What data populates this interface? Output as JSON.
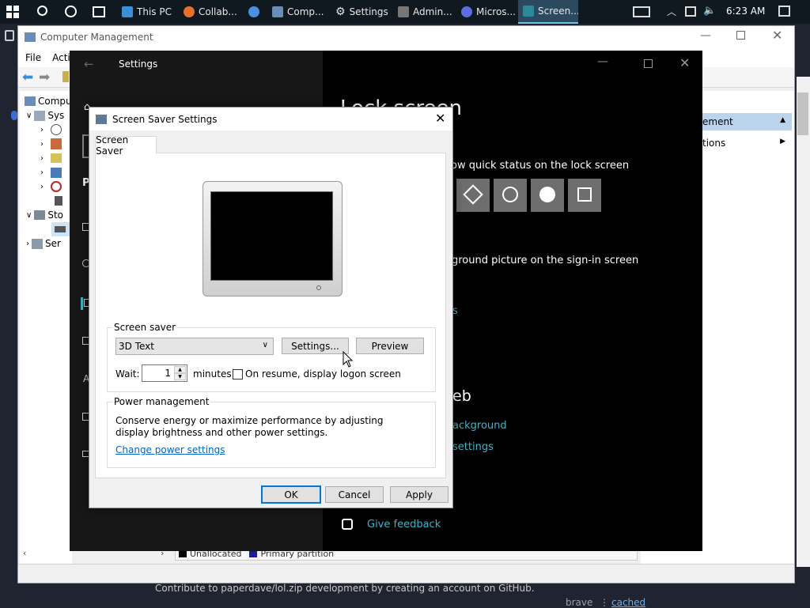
{
  "taskbar": {
    "items": [
      {
        "label": "This PC",
        "icon": "this-pc-icon",
        "color": "#3a8fd8"
      },
      {
        "label": "Collab...",
        "icon": "firefox-icon",
        "color": "#e8702a"
      },
      {
        "label": "",
        "icon": "chrome-icon",
        "color": "#4a90e2"
      },
      {
        "label": "Comp...",
        "icon": "computer-management-icon",
        "color": "#6a8db8"
      },
      {
        "label": "Settings",
        "icon": "gear-icon",
        "color": "#ffffff"
      },
      {
        "label": "Admin...",
        "icon": "cmd-icon",
        "color": "#777777"
      },
      {
        "label": "Micros...",
        "icon": "edge-icon",
        "color": "#5b6ee1"
      },
      {
        "label": "Screen...",
        "icon": "screen-saver-icon",
        "color": "#2a8a9a"
      }
    ],
    "clock": "6:23 AM"
  },
  "computer_management": {
    "title": "Computer Management",
    "menu": [
      "File",
      "Acti"
    ],
    "tree": [
      {
        "label": "Compu",
        "indent": 0
      },
      {
        "label": "Sys",
        "indent": 1
      },
      {
        "label": "",
        "indent": 2
      },
      {
        "label": "",
        "indent": 2
      },
      {
        "label": "",
        "indent": 2
      },
      {
        "label": "",
        "indent": 2
      },
      {
        "label": "",
        "indent": 2
      },
      {
        "label": "",
        "indent": 2
      },
      {
        "label": "Sto",
        "indent": 1
      },
      {
        "label": "",
        "indent": 2
      },
      {
        "label": "Ser",
        "indent": 1
      }
    ],
    "actions": [
      "ement",
      "tions"
    ],
    "legend": [
      "Unallocated",
      "Primary partition"
    ]
  },
  "settings": {
    "title": "Settings",
    "heading": "Lock screen",
    "left_letters": [
      "P",
      "A"
    ],
    "quick_status": "ow quick status on the lock screen",
    "bg_picture": "ground picture on the sign-in screen",
    "link_s": "s",
    "web_heading": "eb",
    "link_background": "ackground",
    "link_settings": "settings",
    "feedback": "Give feedback"
  },
  "dialog": {
    "title": "Screen Saver Settings",
    "tab": "Screen Saver",
    "screensaver_group": "Screen saver",
    "selected": "3D Text",
    "settings_btn": "Settings...",
    "preview_btn": "Preview",
    "wait_label": "Wait:",
    "wait_value": "1",
    "minutes_label": "minutes",
    "resume_label": "On resume, display logon screen",
    "power_group": "Power management",
    "power_text": "Conserve energy or maximize performance by adjusting display brightness and other power settings.",
    "power_link": "Change power settings",
    "ok": "OK",
    "cancel": "Cancel",
    "apply": "Apply"
  },
  "footer": {
    "github": "Contribute to paperdave/lol.zip development by creating an account on GitHub.",
    "brave": "brave",
    "cached": "cached"
  }
}
